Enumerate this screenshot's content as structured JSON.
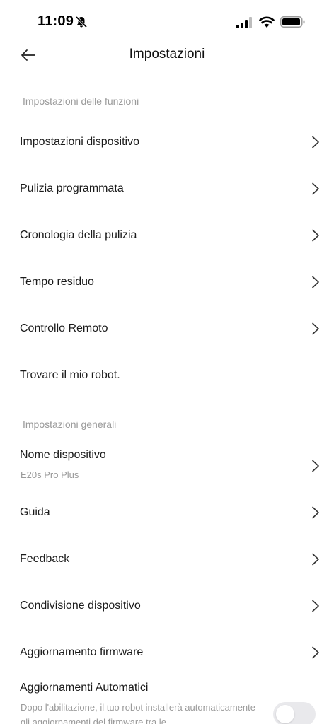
{
  "status_bar": {
    "time": "11:09"
  },
  "header": {
    "title": "Impostazioni"
  },
  "sections": {
    "functions": {
      "title": "Impostazioni delle funzioni",
      "items": [
        {
          "label": "Impostazioni dispositivo"
        },
        {
          "label": "Pulizia programmata"
        },
        {
          "label": "Cronologia della pulizia"
        },
        {
          "label": "Tempo residuo"
        },
        {
          "label": "Controllo Remoto"
        },
        {
          "label": "Trovare il mio robot."
        }
      ]
    },
    "general": {
      "title": "Impostazioni generali",
      "items": [
        {
          "label": "Nome dispositivo",
          "sublabel": "E20s Pro Plus"
        },
        {
          "label": "Guida"
        },
        {
          "label": "Feedback"
        },
        {
          "label": "Condivisione dispositivo"
        },
        {
          "label": "Aggiornamento firmware"
        }
      ],
      "auto_update": {
        "label": "Aggiornamenti Automatici",
        "description": "Dopo l'abilitazione, il tuo robot installerà automaticamente gli aggiornamenti del firmware tra le",
        "enabled": false
      }
    }
  }
}
